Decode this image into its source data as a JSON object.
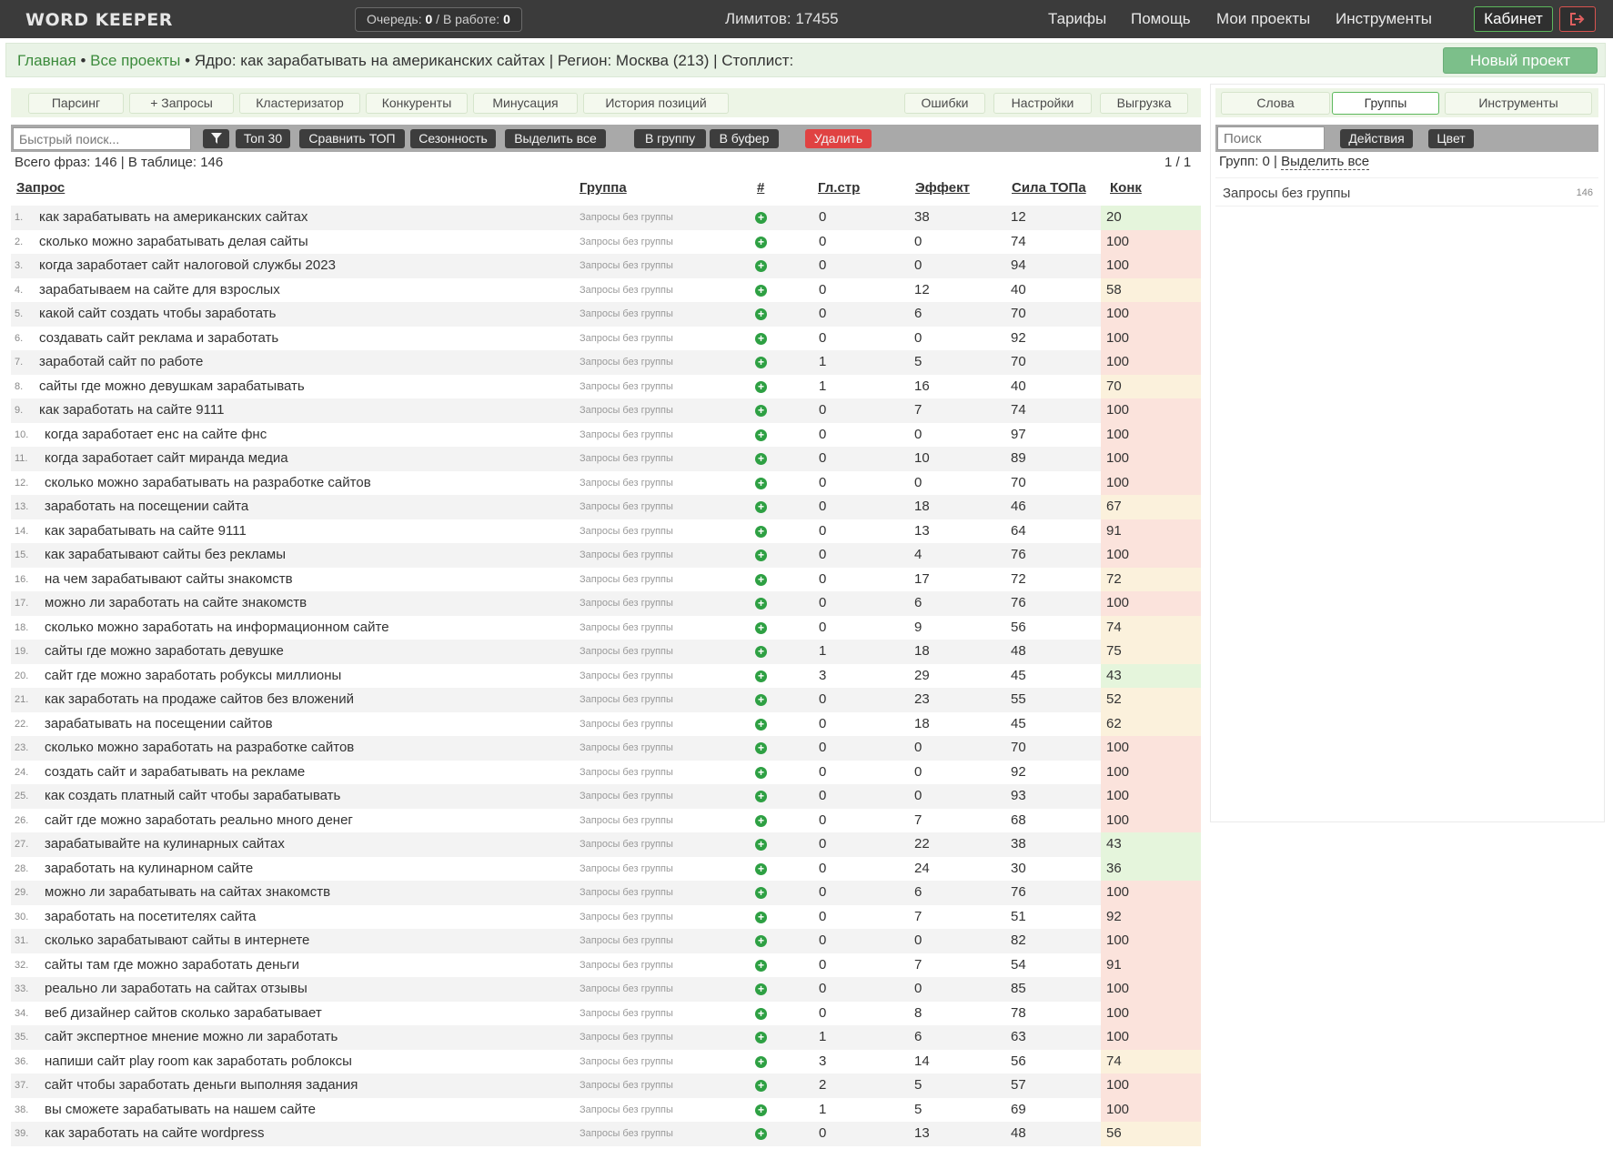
{
  "header": {
    "logo": "WORD KEEPER",
    "queue_label": "Очередь: ",
    "queue_value": "0",
    "work_label": " / В работе: ",
    "work_value": "0",
    "limits": "Лимитов: 17455",
    "nav": [
      "Тарифы",
      "Помощь",
      "Мои проекты",
      "Инструменты"
    ],
    "cabinet": "Кабинет"
  },
  "breadcrumb": {
    "home": "Главная",
    "sep1": " • ",
    "all": "Все проекты",
    "rest": " • Ядро: как зарабатывать на американских сайтах | Регион: Москва (213) | Стоплист:"
  },
  "new_project": "Новый проект",
  "tabs": [
    "Парсинг",
    "+ Запросы",
    "Кластеризатор",
    "Конкуренты",
    "Минусация",
    "История позиций",
    "Ошибки",
    "Настройки",
    "Выгрузка"
  ],
  "toolbar": {
    "search_placeholder": "Быстрый поиск...",
    "buttons": [
      "Топ 30",
      "Сравнить ТОП",
      "Сезонность",
      "Выделить все",
      "В группу",
      "В буфер",
      "Удалить"
    ]
  },
  "stats": "Всего фраз: 146 | В таблице: 146",
  "pages": "1 / 1",
  "columns": [
    "Запрос",
    "Группа",
    "#",
    "Гл.стр",
    "Эффект",
    "Сила ТОПа",
    "Конк"
  ],
  "rows": [
    {
      "n": "1.",
      "q": "как зарабатывать на американских сайтах",
      "g": "Запросы без группы",
      "gl": "0",
      "ef": "38",
      "st": "12",
      "k": "20"
    },
    {
      "n": "2.",
      "q": "сколько можно зарабатывать делая сайты",
      "g": "Запросы без группы",
      "gl": "0",
      "ef": "0",
      "st": "74",
      "k": "100"
    },
    {
      "n": "3.",
      "q": "когда заработает сайт налоговой службы 2023",
      "g": "Запросы без группы",
      "gl": "0",
      "ef": "0",
      "st": "94",
      "k": "100"
    },
    {
      "n": "4.",
      "q": "зарабатываем на сайте для взрослых",
      "g": "Запросы без группы",
      "gl": "0",
      "ef": "12",
      "st": "40",
      "k": "58"
    },
    {
      "n": "5.",
      "q": "какой сайт создать чтобы заработать",
      "g": "Запросы без группы",
      "gl": "0",
      "ef": "6",
      "st": "70",
      "k": "100"
    },
    {
      "n": "6.",
      "q": "создавать сайт реклама и заработать",
      "g": "Запросы без группы",
      "gl": "0",
      "ef": "0",
      "st": "92",
      "k": "100"
    },
    {
      "n": "7.",
      "q": "заработай сайт по работе",
      "g": "Запросы без группы",
      "gl": "1",
      "ef": "5",
      "st": "70",
      "k": "100"
    },
    {
      "n": "8.",
      "q": "сайты где можно девушкам зарабатывать",
      "g": "Запросы без группы",
      "gl": "1",
      "ef": "16",
      "st": "40",
      "k": "70"
    },
    {
      "n": "9.",
      "q": "как заработать на сайте 9111",
      "g": "Запросы без группы",
      "gl": "0",
      "ef": "7",
      "st": "74",
      "k": "100"
    },
    {
      "n": "10.",
      "q": "когда заработает енс на сайте фнс",
      "g": "Запросы без группы",
      "gl": "0",
      "ef": "0",
      "st": "97",
      "k": "100"
    },
    {
      "n": "11.",
      "q": "когда заработает сайт миранда медиа",
      "g": "Запросы без группы",
      "gl": "0",
      "ef": "10",
      "st": "89",
      "k": "100"
    },
    {
      "n": "12.",
      "q": "сколько можно зарабатывать на разработке сайтов",
      "g": "Запросы без группы",
      "gl": "0",
      "ef": "0",
      "st": "70",
      "k": "100"
    },
    {
      "n": "13.",
      "q": "заработать на посещении сайта",
      "g": "Запросы без группы",
      "gl": "0",
      "ef": "18",
      "st": "46",
      "k": "67"
    },
    {
      "n": "14.",
      "q": "как зарабатывать на сайте 9111",
      "g": "Запросы без группы",
      "gl": "0",
      "ef": "13",
      "st": "64",
      "k": "91"
    },
    {
      "n": "15.",
      "q": "как зарабатывают сайты без рекламы",
      "g": "Запросы без группы",
      "gl": "0",
      "ef": "4",
      "st": "76",
      "k": "100"
    },
    {
      "n": "16.",
      "q": "на чем зарабатывают сайты знакомств",
      "g": "Запросы без группы",
      "gl": "0",
      "ef": "17",
      "st": "72",
      "k": "72"
    },
    {
      "n": "17.",
      "q": "можно ли заработать на сайте знакомств",
      "g": "Запросы без группы",
      "gl": "0",
      "ef": "6",
      "st": "76",
      "k": "100"
    },
    {
      "n": "18.",
      "q": "сколько можно заработать на информационном сайте",
      "g": "Запросы без группы",
      "gl": "0",
      "ef": "9",
      "st": "56",
      "k": "74"
    },
    {
      "n": "19.",
      "q": "сайты где можно заработать девушке",
      "g": "Запросы без группы",
      "gl": "1",
      "ef": "18",
      "st": "48",
      "k": "75"
    },
    {
      "n": "20.",
      "q": "сайт где можно заработать робуксы миллионы",
      "g": "Запросы без группы",
      "gl": "3",
      "ef": "29",
      "st": "45",
      "k": "43"
    },
    {
      "n": "21.",
      "q": "как заработать на продаже сайтов без вложений",
      "g": "Запросы без группы",
      "gl": "0",
      "ef": "23",
      "st": "55",
      "k": "52"
    },
    {
      "n": "22.",
      "q": "зарабатывать на посещении сайтов",
      "g": "Запросы без группы",
      "gl": "0",
      "ef": "18",
      "st": "45",
      "k": "62"
    },
    {
      "n": "23.",
      "q": "сколько можно заработать на разработке сайтов",
      "g": "Запросы без группы",
      "gl": "0",
      "ef": "0",
      "st": "70",
      "k": "100"
    },
    {
      "n": "24.",
      "q": "создать сайт и зарабатывать на рекламе",
      "g": "Запросы без группы",
      "gl": "0",
      "ef": "0",
      "st": "92",
      "k": "100"
    },
    {
      "n": "25.",
      "q": "как создать платный сайт чтобы зарабатывать",
      "g": "Запросы без группы",
      "gl": "0",
      "ef": "0",
      "st": "93",
      "k": "100"
    },
    {
      "n": "26.",
      "q": "сайт где можно заработать реально много денег",
      "g": "Запросы без группы",
      "gl": "0",
      "ef": "7",
      "st": "68",
      "k": "100"
    },
    {
      "n": "27.",
      "q": "зарабатывайте на кулинарных сайтах",
      "g": "Запросы без группы",
      "gl": "0",
      "ef": "22",
      "st": "38",
      "k": "43"
    },
    {
      "n": "28.",
      "q": "заработать на кулинарном сайте",
      "g": "Запросы без группы",
      "gl": "0",
      "ef": "24",
      "st": "30",
      "k": "36"
    },
    {
      "n": "29.",
      "q": "можно ли зарабатывать на сайтах знакомств",
      "g": "Запросы без группы",
      "gl": "0",
      "ef": "6",
      "st": "76",
      "k": "100"
    },
    {
      "n": "30.",
      "q": "заработать на посетителях сайта",
      "g": "Запросы без группы",
      "gl": "0",
      "ef": "7",
      "st": "51",
      "k": "92"
    },
    {
      "n": "31.",
      "q": "сколько зарабатывают сайты в интернете",
      "g": "Запросы без группы",
      "gl": "0",
      "ef": "0",
      "st": "82",
      "k": "100"
    },
    {
      "n": "32.",
      "q": "сайты там где можно заработать деньги",
      "g": "Запросы без группы",
      "gl": "0",
      "ef": "7",
      "st": "54",
      "k": "91"
    },
    {
      "n": "33.",
      "q": "реально ли заработать на сайтах отзывы",
      "g": "Запросы без группы",
      "gl": "0",
      "ef": "0",
      "st": "85",
      "k": "100"
    },
    {
      "n": "34.",
      "q": "веб дизайнер сайтов сколько зарабатывает",
      "g": "Запросы без группы",
      "gl": "0",
      "ef": "8",
      "st": "78",
      "k": "100"
    },
    {
      "n": "35.",
      "q": "сайт экспертное мнение можно ли заработать",
      "g": "Запросы без группы",
      "gl": "1",
      "ef": "6",
      "st": "63",
      "k": "100"
    },
    {
      "n": "36.",
      "q": "напиши сайт play room как заработать роблоксы",
      "g": "Запросы без группы",
      "gl": "3",
      "ef": "14",
      "st": "56",
      "k": "74"
    },
    {
      "n": "37.",
      "q": "сайт чтобы заработать деньги выполняя задания",
      "g": "Запросы без группы",
      "gl": "2",
      "ef": "5",
      "st": "57",
      "k": "100"
    },
    {
      "n": "38.",
      "q": "вы сможете зарабатывать на нашем сайте",
      "g": "Запросы без группы",
      "gl": "1",
      "ef": "5",
      "st": "69",
      "k": "100"
    },
    {
      "n": "39.",
      "q": "как заработать на сайте wordpress",
      "g": "Запросы без группы",
      "gl": "0",
      "ef": "13",
      "st": "48",
      "k": "56"
    }
  ],
  "right_panel": {
    "tabs": [
      "Слова",
      "Группы",
      "Инструменты"
    ],
    "search_placeholder": "Поиск",
    "actions": "Действия",
    "color": "Цвет",
    "groups_count": "Групп: 0 | ",
    "select_all": "Выделить все",
    "group_name": "Запросы без группы",
    "group_count": "146"
  },
  "colors": {
    "konk_low": "#e5f5dc",
    "konk_mid": "#fbf1dc",
    "konk_high": "#fbe3dc"
  }
}
